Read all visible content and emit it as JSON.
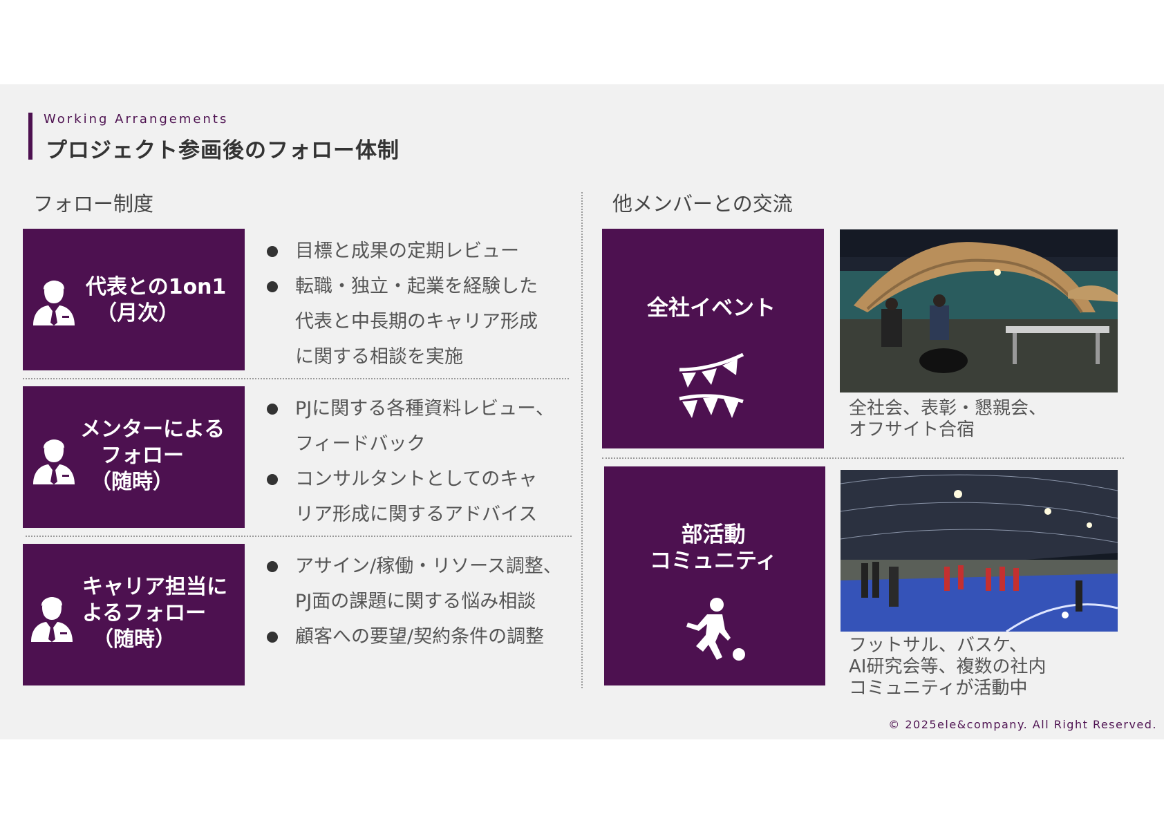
{
  "header": {
    "subtitle": "Working Arrangements",
    "title": "プロジェクト参画後のフォロー体制"
  },
  "follow": {
    "heading": "フォロー制度",
    "items": [
      {
        "label": "代表との1on1\n　（月次）",
        "bullets": [
          "目標と成果の定期レビュー",
          "転職・独立・起業を経験した\n代表と中長期のキャリア形成\nに関する相談を実施"
        ]
      },
      {
        "label": "メンターによる\n　フォロー\n　（随時）",
        "bullets": [
          "PJに関する各種資料レビュー、\nフィードバック",
          "コンサルタントとしてのキャ\nリア形成に関するアドバイス"
        ]
      },
      {
        "label": "キャリア担当に\nよるフォロー\n　（随時）",
        "bullets": [
          "アサイン/稼働・リソース調整、\nPJ面の課題に関する悩み相談",
          "顧客への要望/契約条件の調整"
        ]
      }
    ]
  },
  "exchange": {
    "heading": "他メンバーとの交流",
    "items": [
      {
        "label": "全社イベント",
        "icon": "bunting-flags-icon",
        "caption": "全社会、表彰・懇親会、\nオフサイト合宿"
      },
      {
        "label": "部活動\nコミュニティ",
        "icon": "soccer-player-icon",
        "caption": "フットサル、バスケ、\nAI研究会等、複数の社内\nコミュニティが活動中"
      }
    ]
  },
  "footer": {
    "copyright": "© 2025ele&company. All Right Reserved."
  },
  "colors": {
    "brand": "#4d1150",
    "background": "#f1f1f1",
    "text": "#555555"
  }
}
